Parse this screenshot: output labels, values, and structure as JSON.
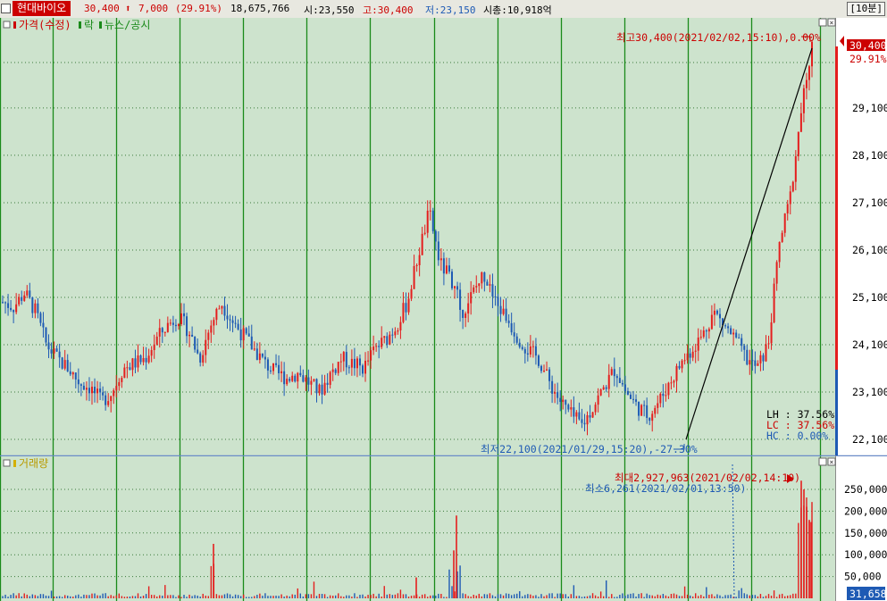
{
  "ticker": {
    "name": "현대바이오",
    "price": "30,400",
    "arrow": "⬆",
    "change": "7,000",
    "change_pct": "(29.91%)",
    "volume": "18,675,766",
    "open": "시:23,550",
    "high": "고:30,400",
    "low": "저:23,150",
    "market_cap": "시총:10,918억",
    "period": "[10분]"
  },
  "price_panel": {
    "legend": {
      "price": "가격(수정)",
      "drop": "락",
      "news": "뉴스/공시"
    },
    "current_price": "30,400",
    "current_pct": "29.91%",
    "high_note": "최고30,400(2021/02/02,15:10),0.00%",
    "low_note": "최저22,100(2021/01/29,15:20),-27.30%",
    "stats": {
      "lh": "LH : 37.56%",
      "lc": "LC : 37.56%",
      "hc": "HC :  0.00%"
    },
    "y_ticks": [
      "29,100",
      "28,100",
      "27,100",
      "26,100",
      "25,100",
      "24,100",
      "23,100",
      "22,100"
    ]
  },
  "volume_panel": {
    "legend": "거래량",
    "max_note": "최대2,927,963(2021/02/02,14:10)",
    "min_note": "최소6,261(2021/02/01,13:50)",
    "current_volume": "31,658",
    "y_ticks": [
      "250,000",
      "200,000",
      "150,000",
      "100,000",
      "50,000"
    ]
  },
  "colors": {
    "panel_bg": "#cde3cd",
    "grid_green": "#1a8a1a",
    "rise": "#e41e1e",
    "fall": "#1e5ab4",
    "scale_bg": "#ffffff"
  },
  "chart_data": {
    "type": "candlestick-with-volume",
    "interval": "10분",
    "price_series": [
      25000,
      24900,
      25200,
      24800,
      24100,
      23800,
      23600,
      23300,
      23200,
      22900,
      23100,
      23600,
      23700,
      23800,
      24200,
      24500,
      24700,
      24400,
      23800,
      24500,
      25000,
      24600,
      24300,
      24000,
      23700,
      23500,
      23400,
      23500,
      23300,
      23100,
      23500,
      23800,
      23700,
      23600,
      24000,
      24200,
      24500,
      25000,
      26000,
      26900,
      25800,
      25500,
      24800,
      25200,
      25600,
      25000,
      24700,
      24300,
      24000,
      23800,
      23300,
      22900,
      22600,
      22400,
      22800,
      23200,
      23600,
      23100,
      22800,
      22600,
      22900,
      23300,
      23700,
      24000,
      24300,
      24800,
      24500,
      24200,
      23800,
      23600,
      24100,
      26200,
      27200,
      29000,
      30400
    ],
    "volume_max": 2927963,
    "volume_min": 6261,
    "y_ticks": [
      22100,
      23100,
      24100,
      25100,
      26100,
      27100,
      28100,
      29100
    ],
    "volume_ticks": [
      50000,
      100000,
      150000,
      200000,
      250000
    ],
    "high": 30400,
    "low": 22100
  }
}
